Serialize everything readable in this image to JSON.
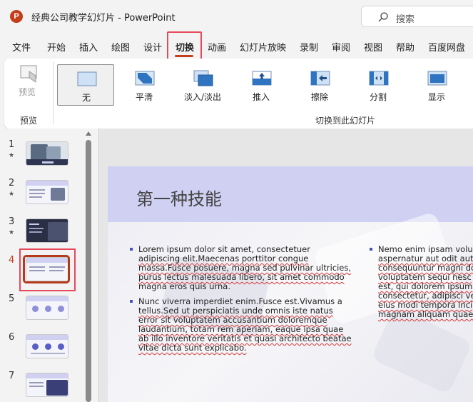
{
  "window": {
    "logo_letter": "P",
    "title": "经典公司教学幻灯片 - PowerPoint",
    "search_placeholder": "搜索"
  },
  "tabs": [
    {
      "label": "文件",
      "active": false
    },
    {
      "label": "开始",
      "active": false
    },
    {
      "label": "插入",
      "active": false
    },
    {
      "label": "绘图",
      "active": false
    },
    {
      "label": "设计",
      "active": false
    },
    {
      "label": "切换",
      "active": true
    },
    {
      "label": "动画",
      "active": false
    },
    {
      "label": "幻灯片放映",
      "active": false
    },
    {
      "label": "录制",
      "active": false
    },
    {
      "label": "审阅",
      "active": false
    },
    {
      "label": "视图",
      "active": false
    },
    {
      "label": "帮助",
      "active": false
    },
    {
      "label": "百度网盘",
      "active": false
    }
  ],
  "ribbon": {
    "preview_label": "预览",
    "preview_group_label": "预览",
    "transitions_group_label": "切换到此幻灯片",
    "transitions": [
      {
        "label": "无",
        "icon": "none-transition-icon",
        "selected": true
      },
      {
        "label": "平滑",
        "icon": "morph-transition-icon",
        "selected": false
      },
      {
        "label": "淡入/淡出",
        "icon": "fade-transition-icon",
        "selected": false
      },
      {
        "label": "推入",
        "icon": "push-transition-icon",
        "selected": false
      },
      {
        "label": "擦除",
        "icon": "wipe-transition-icon",
        "selected": false
      },
      {
        "label": "分割",
        "icon": "split-transition-icon",
        "selected": false
      },
      {
        "label": "显示",
        "icon": "reveal-transition-icon",
        "selected": false
      }
    ]
  },
  "thumbnails": [
    {
      "number": "1",
      "star": "★",
      "active": false
    },
    {
      "number": "2",
      "star": "★",
      "active": false
    },
    {
      "number": "3",
      "star": "★",
      "active": false
    },
    {
      "number": "4",
      "star": "",
      "active": true
    },
    {
      "number": "5",
      "star": "",
      "active": false
    },
    {
      "number": "6",
      "star": "",
      "active": false
    },
    {
      "number": "7",
      "star": "",
      "active": false
    }
  ],
  "slide": {
    "title": "第一种技能",
    "left_column": [
      [
        "Lorem ipsum dolor sit amet, consectetuer",
        "adipiscing elit.Maecenas porttitor congue",
        "massa.Fusce posuere, magna sed pulvinar ultricies,",
        "purus lectus malesuada libero, sit amet commodo",
        "magna eros quis urna."
      ],
      [
        "Nunc viverra imperdiet enim.Fusce est.Vivamus a",
        "tellus.Sed ut perspiciatis unde omnis iste natus",
        "error sit voluptatem accusantium doloremque",
        "laudantium, totam rem aperiam, eaque ipsa quae",
        "ab illo inventore veritatis et quasi architecto beatae",
        "vitae dicta sunt explicabo."
      ]
    ],
    "right_column": [
      [
        "Nemo enim ipsam volu",
        "aspernatur aut odit aut",
        "consequuntur magni do",
        "voluptatem sequi nesc",
        "est, qui dolorem ipsum",
        "consectetur, adipisci ve",
        "eius modi tempora inci",
        "magnam aliquam quae"
      ]
    ]
  },
  "colors": {
    "accent": "#c43e1c",
    "highlight_box": "#e8485a",
    "slide_title_band": "#cfd0f2",
    "bullet": "#4a4fc0"
  }
}
